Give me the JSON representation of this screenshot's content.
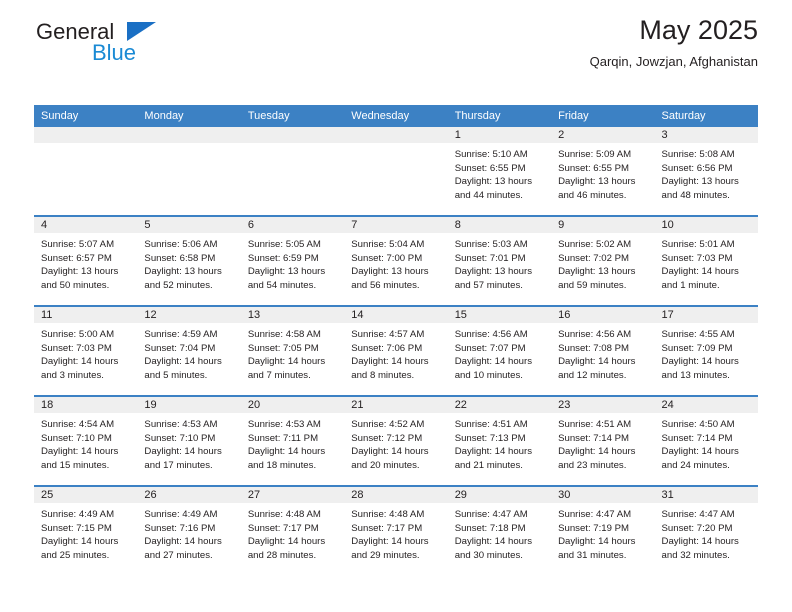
{
  "brand": {
    "general": "General",
    "blue": "Blue",
    "triangle_color": "#1a6fc4",
    "blue_color": "#1a8ad4"
  },
  "header": {
    "title": "May 2025",
    "subtitle": "Qarqin, Jowzjan, Afghanistan"
  },
  "theme": {
    "header_bg": "#3c81c4",
    "daynum_bg": "#efefef",
    "text": "#231f20"
  },
  "weekdays": [
    "Sunday",
    "Monday",
    "Tuesday",
    "Wednesday",
    "Thursday",
    "Friday",
    "Saturday"
  ],
  "labels": {
    "sunrise_prefix": "Sunrise:",
    "sunset_prefix": "Sunset:",
    "daylight_prefix": "Daylight:"
  },
  "weeks": [
    [
      {
        "day": "",
        "sunrise": "",
        "sunset": "",
        "daylight_line1": "",
        "daylight_line2": ""
      },
      {
        "day": "",
        "sunrise": "",
        "sunset": "",
        "daylight_line1": "",
        "daylight_line2": ""
      },
      {
        "day": "",
        "sunrise": "",
        "sunset": "",
        "daylight_line1": "",
        "daylight_line2": ""
      },
      {
        "day": "",
        "sunrise": "",
        "sunset": "",
        "daylight_line1": "",
        "daylight_line2": ""
      },
      {
        "day": "1",
        "sunrise": "Sunrise: 5:10 AM",
        "sunset": "Sunset: 6:55 PM",
        "daylight_line1": "Daylight: 13 hours",
        "daylight_line2": "and 44 minutes."
      },
      {
        "day": "2",
        "sunrise": "Sunrise: 5:09 AM",
        "sunset": "Sunset: 6:55 PM",
        "daylight_line1": "Daylight: 13 hours",
        "daylight_line2": "and 46 minutes."
      },
      {
        "day": "3",
        "sunrise": "Sunrise: 5:08 AM",
        "sunset": "Sunset: 6:56 PM",
        "daylight_line1": "Daylight: 13 hours",
        "daylight_line2": "and 48 minutes."
      }
    ],
    [
      {
        "day": "4",
        "sunrise": "Sunrise: 5:07 AM",
        "sunset": "Sunset: 6:57 PM",
        "daylight_line1": "Daylight: 13 hours",
        "daylight_line2": "and 50 minutes."
      },
      {
        "day": "5",
        "sunrise": "Sunrise: 5:06 AM",
        "sunset": "Sunset: 6:58 PM",
        "daylight_line1": "Daylight: 13 hours",
        "daylight_line2": "and 52 minutes."
      },
      {
        "day": "6",
        "sunrise": "Sunrise: 5:05 AM",
        "sunset": "Sunset: 6:59 PM",
        "daylight_line1": "Daylight: 13 hours",
        "daylight_line2": "and 54 minutes."
      },
      {
        "day": "7",
        "sunrise": "Sunrise: 5:04 AM",
        "sunset": "Sunset: 7:00 PM",
        "daylight_line1": "Daylight: 13 hours",
        "daylight_line2": "and 56 minutes."
      },
      {
        "day": "8",
        "sunrise": "Sunrise: 5:03 AM",
        "sunset": "Sunset: 7:01 PM",
        "daylight_line1": "Daylight: 13 hours",
        "daylight_line2": "and 57 minutes."
      },
      {
        "day": "9",
        "sunrise": "Sunrise: 5:02 AM",
        "sunset": "Sunset: 7:02 PM",
        "daylight_line1": "Daylight: 13 hours",
        "daylight_line2": "and 59 minutes."
      },
      {
        "day": "10",
        "sunrise": "Sunrise: 5:01 AM",
        "sunset": "Sunset: 7:03 PM",
        "daylight_line1": "Daylight: 14 hours",
        "daylight_line2": "and 1 minute."
      }
    ],
    [
      {
        "day": "11",
        "sunrise": "Sunrise: 5:00 AM",
        "sunset": "Sunset: 7:03 PM",
        "daylight_line1": "Daylight: 14 hours",
        "daylight_line2": "and 3 minutes."
      },
      {
        "day": "12",
        "sunrise": "Sunrise: 4:59 AM",
        "sunset": "Sunset: 7:04 PM",
        "daylight_line1": "Daylight: 14 hours",
        "daylight_line2": "and 5 minutes."
      },
      {
        "day": "13",
        "sunrise": "Sunrise: 4:58 AM",
        "sunset": "Sunset: 7:05 PM",
        "daylight_line1": "Daylight: 14 hours",
        "daylight_line2": "and 7 minutes."
      },
      {
        "day": "14",
        "sunrise": "Sunrise: 4:57 AM",
        "sunset": "Sunset: 7:06 PM",
        "daylight_line1": "Daylight: 14 hours",
        "daylight_line2": "and 8 minutes."
      },
      {
        "day": "15",
        "sunrise": "Sunrise: 4:56 AM",
        "sunset": "Sunset: 7:07 PM",
        "daylight_line1": "Daylight: 14 hours",
        "daylight_line2": "and 10 minutes."
      },
      {
        "day": "16",
        "sunrise": "Sunrise: 4:56 AM",
        "sunset": "Sunset: 7:08 PM",
        "daylight_line1": "Daylight: 14 hours",
        "daylight_line2": "and 12 minutes."
      },
      {
        "day": "17",
        "sunrise": "Sunrise: 4:55 AM",
        "sunset": "Sunset: 7:09 PM",
        "daylight_line1": "Daylight: 14 hours",
        "daylight_line2": "and 13 minutes."
      }
    ],
    [
      {
        "day": "18",
        "sunrise": "Sunrise: 4:54 AM",
        "sunset": "Sunset: 7:10 PM",
        "daylight_line1": "Daylight: 14 hours",
        "daylight_line2": "and 15 minutes."
      },
      {
        "day": "19",
        "sunrise": "Sunrise: 4:53 AM",
        "sunset": "Sunset: 7:10 PM",
        "daylight_line1": "Daylight: 14 hours",
        "daylight_line2": "and 17 minutes."
      },
      {
        "day": "20",
        "sunrise": "Sunrise: 4:53 AM",
        "sunset": "Sunset: 7:11 PM",
        "daylight_line1": "Daylight: 14 hours",
        "daylight_line2": "and 18 minutes."
      },
      {
        "day": "21",
        "sunrise": "Sunrise: 4:52 AM",
        "sunset": "Sunset: 7:12 PM",
        "daylight_line1": "Daylight: 14 hours",
        "daylight_line2": "and 20 minutes."
      },
      {
        "day": "22",
        "sunrise": "Sunrise: 4:51 AM",
        "sunset": "Sunset: 7:13 PM",
        "daylight_line1": "Daylight: 14 hours",
        "daylight_line2": "and 21 minutes."
      },
      {
        "day": "23",
        "sunrise": "Sunrise: 4:51 AM",
        "sunset": "Sunset: 7:14 PM",
        "daylight_line1": "Daylight: 14 hours",
        "daylight_line2": "and 23 minutes."
      },
      {
        "day": "24",
        "sunrise": "Sunrise: 4:50 AM",
        "sunset": "Sunset: 7:14 PM",
        "daylight_line1": "Daylight: 14 hours",
        "daylight_line2": "and 24 minutes."
      }
    ],
    [
      {
        "day": "25",
        "sunrise": "Sunrise: 4:49 AM",
        "sunset": "Sunset: 7:15 PM",
        "daylight_line1": "Daylight: 14 hours",
        "daylight_line2": "and 25 minutes."
      },
      {
        "day": "26",
        "sunrise": "Sunrise: 4:49 AM",
        "sunset": "Sunset: 7:16 PM",
        "daylight_line1": "Daylight: 14 hours",
        "daylight_line2": "and 27 minutes."
      },
      {
        "day": "27",
        "sunrise": "Sunrise: 4:48 AM",
        "sunset": "Sunset: 7:17 PM",
        "daylight_line1": "Daylight: 14 hours",
        "daylight_line2": "and 28 minutes."
      },
      {
        "day": "28",
        "sunrise": "Sunrise: 4:48 AM",
        "sunset": "Sunset: 7:17 PM",
        "daylight_line1": "Daylight: 14 hours",
        "daylight_line2": "and 29 minutes."
      },
      {
        "day": "29",
        "sunrise": "Sunrise: 4:47 AM",
        "sunset": "Sunset: 7:18 PM",
        "daylight_line1": "Daylight: 14 hours",
        "daylight_line2": "and 30 minutes."
      },
      {
        "day": "30",
        "sunrise": "Sunrise: 4:47 AM",
        "sunset": "Sunset: 7:19 PM",
        "daylight_line1": "Daylight: 14 hours",
        "daylight_line2": "and 31 minutes."
      },
      {
        "day": "31",
        "sunrise": "Sunrise: 4:47 AM",
        "sunset": "Sunset: 7:20 PM",
        "daylight_line1": "Daylight: 14 hours",
        "daylight_line2": "and 32 minutes."
      }
    ]
  ]
}
